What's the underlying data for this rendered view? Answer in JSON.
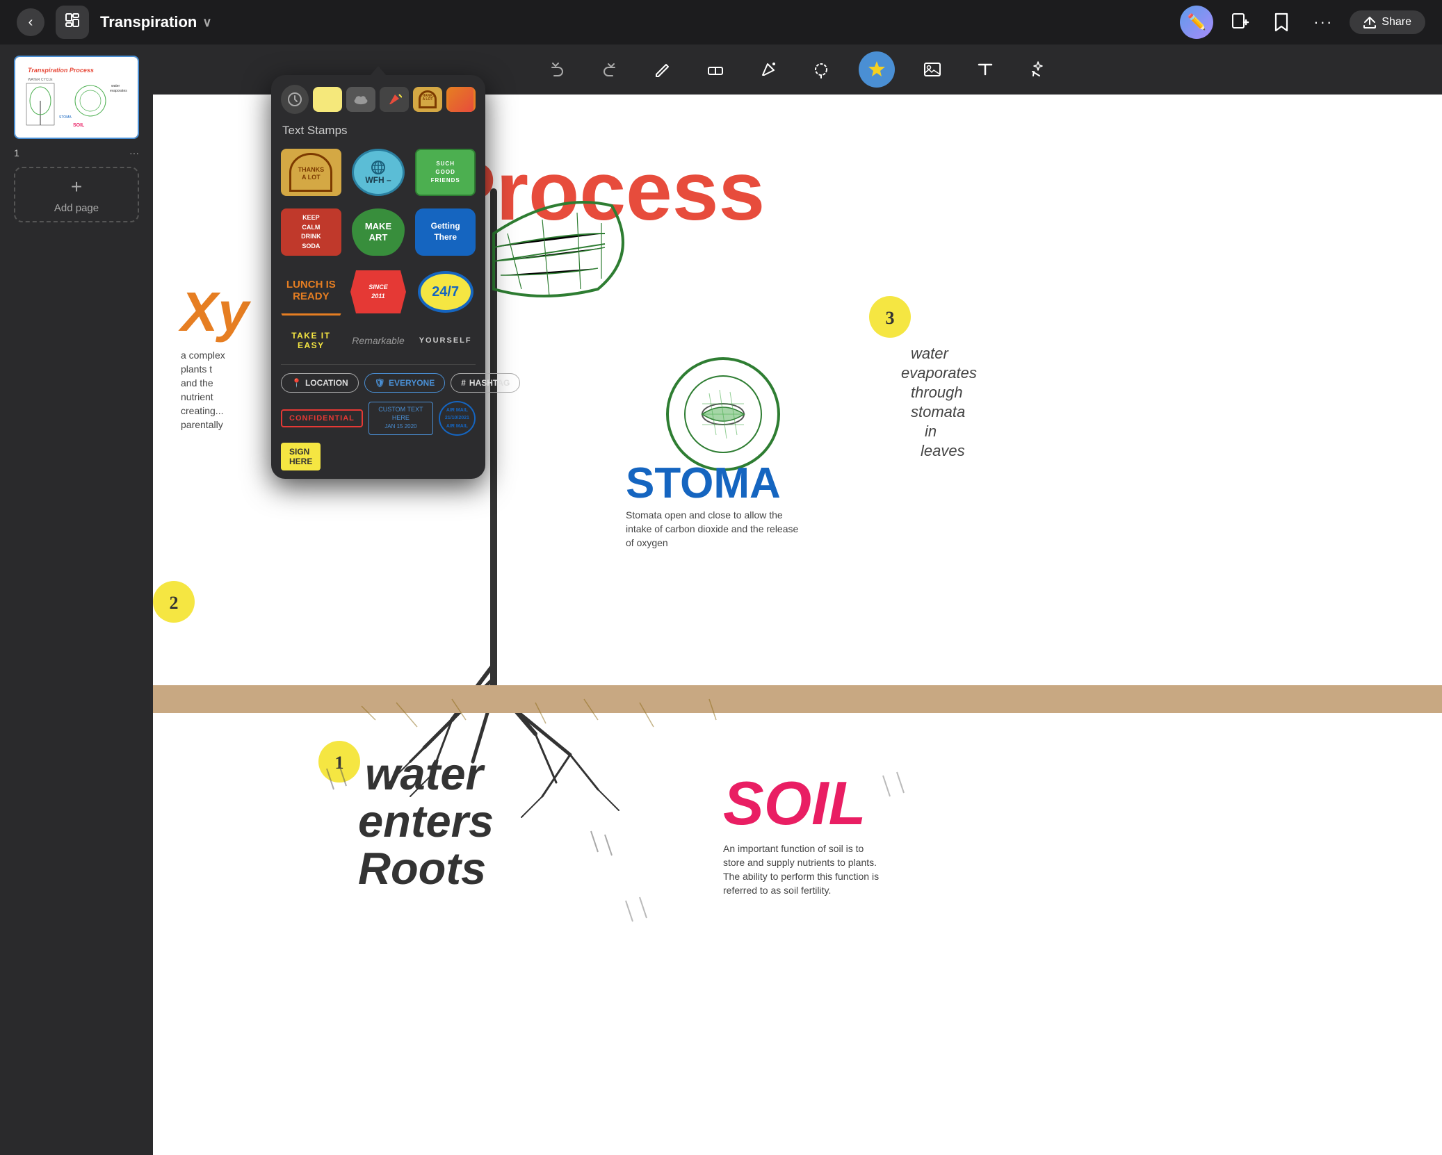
{
  "app": {
    "title": "Transpiration",
    "back_label": "‹",
    "logo": "≡"
  },
  "toolbar": {
    "undo_label": "↩",
    "redo_label": "↪",
    "pencil_label": "✏",
    "eraser_label": "◻",
    "pen_label": "✒",
    "lasso_label": "⊙",
    "shapes_label": "◯",
    "sticker_label": "★",
    "image_label": "⊞",
    "text_label": "T",
    "magic_label": "✦"
  },
  "top_icons": {
    "add_page": "⊕",
    "bookmark": "🔖",
    "more": "···",
    "share": "Share"
  },
  "sidebar": {
    "slide_num": "1",
    "more_dots": "···",
    "add_page_label": "Add page"
  },
  "sticker_panel": {
    "section_title": "Text Stamps",
    "tabs": [
      "clock",
      "square",
      "cloud",
      "pen-sticker",
      "thanks-sticker",
      "orange-sticker"
    ],
    "stickers": [
      {
        "id": "thanks-a-lot",
        "label": "THANKS\nA LOT",
        "type": "arch-gold"
      },
      {
        "id": "wfh",
        "label": "WFH –",
        "type": "circle-blue"
      },
      {
        "id": "good-friends",
        "label": "SUCH\nGOOD\nFRIENDS",
        "type": "rect-green"
      },
      {
        "id": "keep-calm",
        "label": "KEEP\nCALM\nDRINK\nSODA",
        "type": "rect-red"
      },
      {
        "id": "make-art",
        "label": "MAKE\nART",
        "type": "bubble-green"
      },
      {
        "id": "getting-there",
        "label": "Getting\nThere",
        "type": "rect-blue"
      },
      {
        "id": "lunch-is-ready",
        "label": "LUNCH IS\nREADY",
        "type": "text-orange"
      },
      {
        "id": "since-2011",
        "label": "SINCE\n2011",
        "type": "hexagon-red"
      },
      {
        "id": "24-7",
        "label": "24/7",
        "type": "oval-yellow-blue"
      }
    ],
    "text_stamps": [
      {
        "id": "take-it-easy",
        "label": "TAKE IT EASY",
        "style": "yellow"
      },
      {
        "id": "remarkable",
        "label": "Remarkable",
        "style": "gray-italic"
      },
      {
        "id": "yourself",
        "label": "YOURSELF",
        "style": "light"
      }
    ],
    "tags": [
      {
        "id": "location",
        "label": "LOCATION",
        "icon": "📍"
      },
      {
        "id": "everyone",
        "label": "EVERYONE",
        "icon": "🛡"
      },
      {
        "id": "hashtag",
        "label": "HASHTAG",
        "icon": "#"
      }
    ],
    "stamps": [
      {
        "id": "confidential",
        "label": "CONFIDENTIAL",
        "style": "red-border"
      },
      {
        "id": "custom-text",
        "label": "CUSTOM TEXT HERE\nJAN 15 2020",
        "style": "blue-border"
      },
      {
        "id": "air-mail",
        "label": "AIR MAIL\n21/10/2021\nAIR MAIL",
        "style": "circle-blue"
      }
    ],
    "sign_here": {
      "label": "SIGN\nHERE"
    }
  },
  "canvas": {
    "main_title": "ion Process",
    "xy_label": "Xy",
    "xy_description": "a complex\nplants t\nand the\nnutrient\ncreat...\nparent...",
    "stoma_label": "STOMA",
    "stoma_desc": "Stomata open and close to allow the intake of carbon dioxide and the release of oxygen",
    "water_label": "water\nenters\nRoots",
    "soil_label": "SOIL",
    "soil_desc": "An important function of soil is to store and supply nutrients to plants. The ability to perform this function is referred to as soil fertility.",
    "water_evap": "water\nevaporates\nthrough\nstomata\nin\nleaves",
    "num_1": "1",
    "num_2": "2",
    "num_3": "3"
  },
  "colors": {
    "bg_dark": "#1a1a1a",
    "topbar": "#1c1c1e",
    "sidebar_bg": "#2a2a2c",
    "panel_bg": "#2c2c2e",
    "accent_blue": "#4a8fd4",
    "canvas_white": "#ffffff"
  }
}
